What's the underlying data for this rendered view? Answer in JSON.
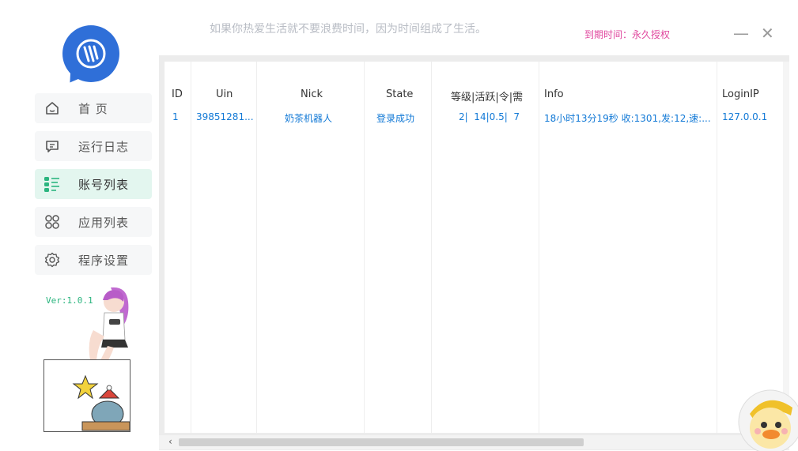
{
  "header": {
    "slogan": "如果你热爱生活就不要浪费时间，因为时间组成了生活。",
    "expire_label": "到期时间：永久授权",
    "minimize_glyph": "—",
    "close_glyph": "✕"
  },
  "sidebar": {
    "items": [
      {
        "label": "首 页",
        "icon": "home-icon",
        "active": false
      },
      {
        "label": "运行日志",
        "icon": "log-icon",
        "active": false
      },
      {
        "label": "账号列表",
        "icon": "list-icon",
        "active": true
      },
      {
        "label": "应用列表",
        "icon": "apps-icon",
        "active": false
      },
      {
        "label": "程序设置",
        "icon": "gear-icon",
        "active": false
      }
    ],
    "version": "Ver:1.0.1"
  },
  "table": {
    "columns": [
      "ID",
      "Uin",
      "Nick",
      "State",
      "等级|活跃|令|需",
      "Info",
      "LoginIP"
    ],
    "rows": [
      {
        "id": "1",
        "uin": "39851281...",
        "nick": "奶茶机器人",
        "state": "登录成功",
        "level": "2|  14|0.5|  7",
        "info": "18小时13分19秒 收:1301,发:12,速:...",
        "ip": "127.0.0.1"
      }
    ]
  },
  "scrollbar": {
    "left_arrow": "‹"
  },
  "colors": {
    "accent": "#2f6fd8",
    "active_bg": "#e3f6ef",
    "link": "#1279d6",
    "expire": "#e0479e",
    "version": "#2bb57f"
  }
}
